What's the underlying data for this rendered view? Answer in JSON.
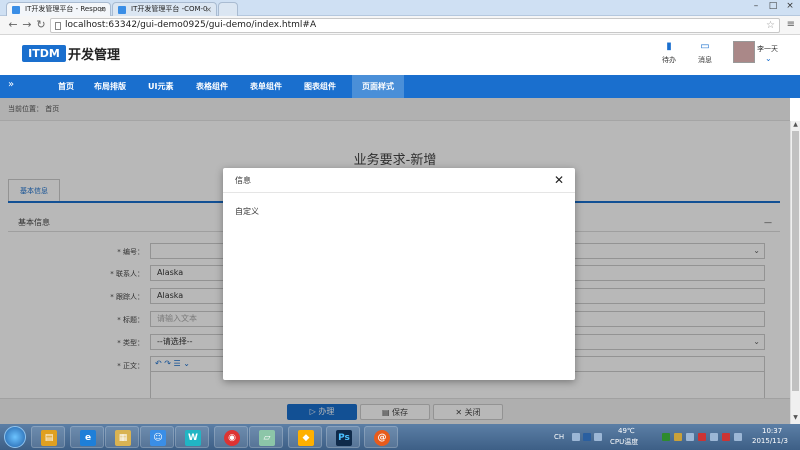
{
  "browser": {
    "tabs": [
      {
        "title": "IT开发管理平台 - Respon",
        "active": true
      },
      {
        "title": "IT开发管理平台 -COM-0",
        "active": false
      }
    ],
    "url": "localhost:63342/gui-demo0925/gui-demo/index.html#A"
  },
  "header": {
    "logo": "ITDM",
    "title": "开发管理",
    "todo_label": "待办",
    "message_label": "消息",
    "username": "李一天"
  },
  "nav": {
    "items": [
      "首页",
      "布局排版",
      "UI元素",
      "表格组件",
      "表单组件",
      "图表组件",
      "页面样式"
    ],
    "active_index": 6
  },
  "breadcrumb": {
    "prefix": "当前位置：",
    "current": "首页"
  },
  "form": {
    "title": "业务要求-新增",
    "tab": "基本信息",
    "section": "基本信息",
    "fields": [
      {
        "label": "* 编号：",
        "value": ""
      },
      {
        "label": "* 联系人：",
        "value": "Alaska"
      },
      {
        "label": "* 跟踪人：",
        "value": "Alaska"
      },
      {
        "label": "* 标题：",
        "value": "请输入文本"
      },
      {
        "label": "* 类型：",
        "value": "--请选择--"
      },
      {
        "label": "* 正文：",
        "value": ""
      }
    ],
    "buttons": {
      "submit": "办理",
      "save": "保存",
      "close": "关闭"
    }
  },
  "modal": {
    "title": "信息",
    "body": "自定义"
  },
  "taskbar": {
    "tray_temp": "49℃",
    "tray_temp_label": "CPU温度",
    "time": "10:37",
    "date": "2015/11/3",
    "lang": "CH"
  },
  "colors": {
    "brand": "#1a6fce",
    "overlay": "rgba(0,0,0,0.28)"
  }
}
